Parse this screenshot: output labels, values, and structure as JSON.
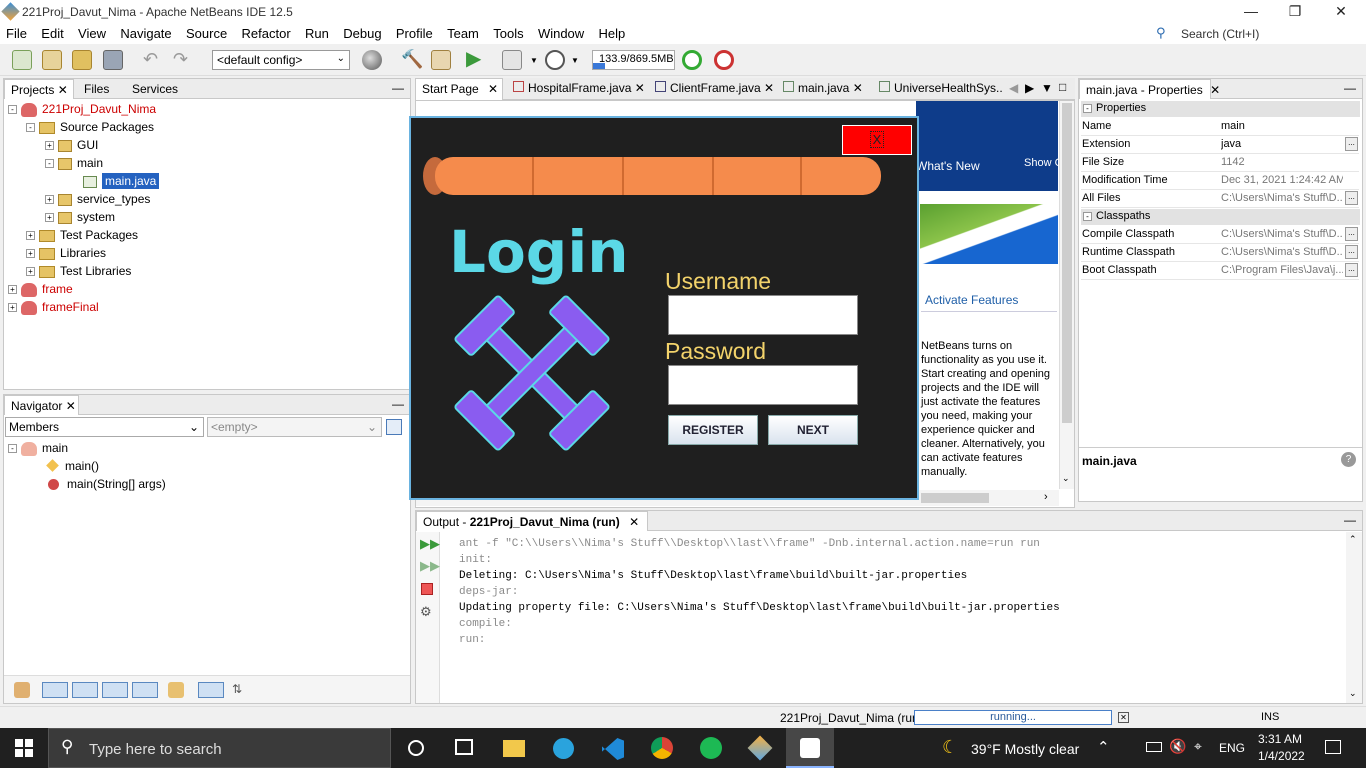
{
  "window": {
    "title": "221Proj_Davut_Nima - Apache NetBeans IDE 12.5"
  },
  "menu": [
    "File",
    "Edit",
    "View",
    "Navigate",
    "Source",
    "Refactor",
    "Run",
    "Debug",
    "Profile",
    "Team",
    "Tools",
    "Window",
    "Help"
  ],
  "search": {
    "placeholder": "Search (Ctrl+I)"
  },
  "toolbar": {
    "config": "<default config>",
    "memory": "133.9/869.5MB",
    "memory_fraction": 0.154
  },
  "projects_panel": {
    "tabs": [
      "Projects",
      "Files",
      "Services"
    ],
    "tree": [
      {
        "label": "221Proj_Davut_Nima",
        "level": 0,
        "red": true
      },
      {
        "label": "Source Packages",
        "level": 1
      },
      {
        "label": "GUI",
        "level": 2
      },
      {
        "label": "main",
        "level": 2
      },
      {
        "label": "main.java",
        "level": 3,
        "selected": true
      },
      {
        "label": "service_types",
        "level": 2
      },
      {
        "label": "system",
        "level": 2
      },
      {
        "label": "Test Packages",
        "level": 1
      },
      {
        "label": "Libraries",
        "level": 1
      },
      {
        "label": "Test Libraries",
        "level": 1
      },
      {
        "label": "frame",
        "level": 0,
        "red": true
      },
      {
        "label": "frameFinal",
        "level": 0,
        "red": true
      }
    ]
  },
  "navigator": {
    "tab": "Navigator",
    "members_label": "Members",
    "empty_label": "<empty>",
    "items": [
      "main",
      "main()",
      "main(String[] args)"
    ]
  },
  "editor_tabs": [
    "Start Page",
    "HospitalFrame.java",
    "ClientFrame.java",
    "main.java",
    "UniverseHealthSys..."
  ],
  "start_page": {
    "whats_new": "What's New",
    "show": "Show C",
    "activate": "Activate Features",
    "desc": [
      "NetBeans turns on",
      "functionality as you use it.",
      "Start creating and opening",
      "projects and the IDE will",
      "just activate the features",
      "you need, making your",
      "experience quicker and",
      "cleaner. Alternatively, you",
      "can activate features",
      "manually."
    ]
  },
  "login": {
    "close": "X",
    "title": "Login",
    "username_label": "Username",
    "password_label": "Password",
    "register": "REGISTER",
    "next": "NEXT"
  },
  "properties": {
    "tab": "main.java - Properties",
    "section1": "Properties",
    "rows1": [
      {
        "k": "Name",
        "v": "main"
      },
      {
        "k": "Extension",
        "v": "java"
      },
      {
        "k": "File Size",
        "v": "1142"
      },
      {
        "k": "Modification Time",
        "v": "Dec 31, 2021 1:24:42 AM"
      },
      {
        "k": "All Files",
        "v": "C:\\Users\\Nima's Stuff\\D..."
      }
    ],
    "section2": "Classpaths",
    "rows2": [
      {
        "k": "Compile Classpath",
        "v": "C:\\Users\\Nima's Stuff\\D..."
      },
      {
        "k": "Runtime Classpath",
        "v": "C:\\Users\\Nima's Stuff\\D..."
      },
      {
        "k": "Boot Classpath",
        "v": "C:\\Program Files\\Java\\j..."
      }
    ],
    "footer": "main.java"
  },
  "output": {
    "tab_prefix": "Output - ",
    "tab_bold": "221Proj_Davut_Nima (run)",
    "lines": [
      {
        "t": "ant -f \"C:\\\\Users\\\\Nima's Stuff\\\\Desktop\\\\last\\\\frame\" -Dnb.internal.action.name=run run",
        "grey": true
      },
      {
        "t": "init:",
        "grey": true
      },
      {
        "t": "Deleting: C:\\Users\\Nima's Stuff\\Desktop\\last\\frame\\build\\built-jar.properties",
        "grey": false
      },
      {
        "t": "deps-jar:",
        "grey": true
      },
      {
        "t": "Updating property file: C:\\Users\\Nima's Stuff\\Desktop\\last\\frame\\build\\built-jar.properties",
        "grey": false
      },
      {
        "t": "compile:",
        "grey": true
      },
      {
        "t": "run:",
        "grey": true
      }
    ]
  },
  "statusbar": {
    "project": "221Proj_Davut_Nima (run)",
    "progress": "running...",
    "mode": "INS"
  },
  "taskbar": {
    "search": "Type here to search",
    "weather": "39°F  Mostly clear",
    "lang": "ENG",
    "time": "3:31 AM",
    "date": "1/4/2022"
  }
}
